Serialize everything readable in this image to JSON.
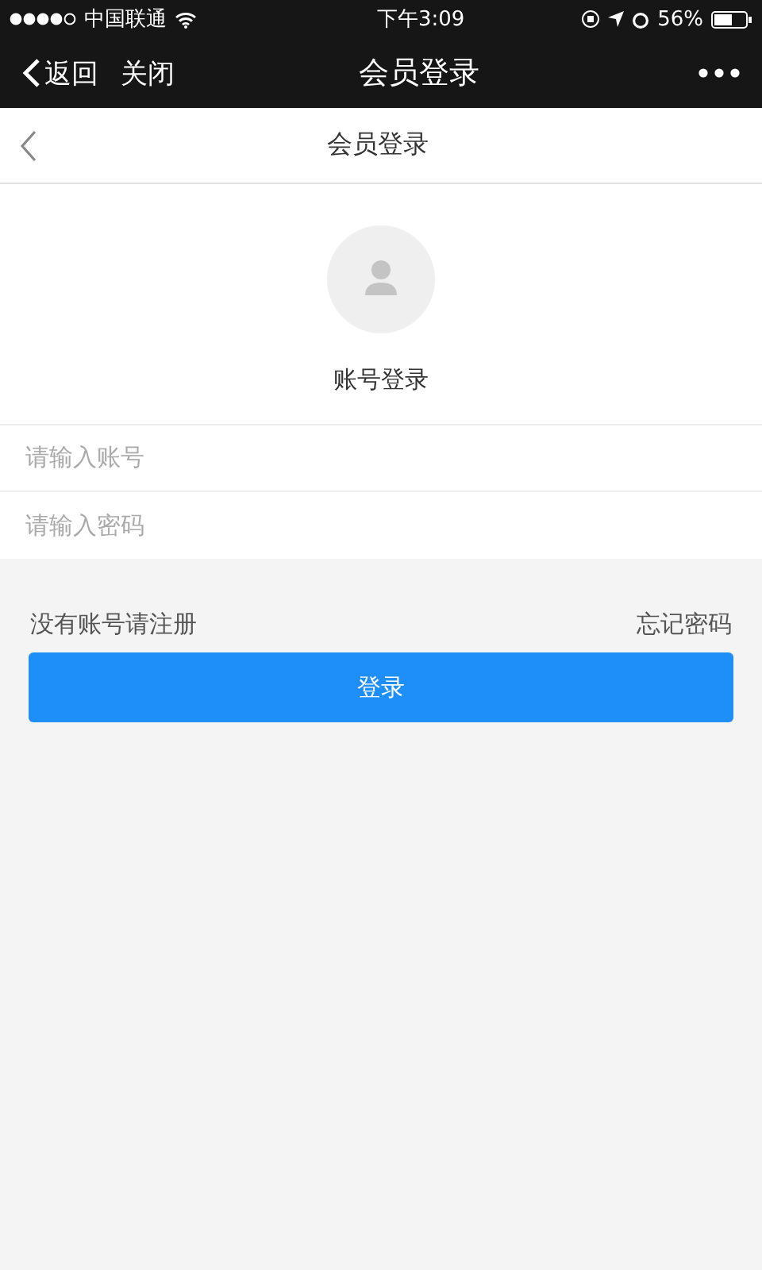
{
  "status_bar": {
    "carrier": "中国联通",
    "time": "下午3:09",
    "battery": "56%"
  },
  "nav_bar": {
    "back": "返回",
    "close": "关闭",
    "title": "会员登录"
  },
  "header": {
    "title": "会员登录"
  },
  "profile": {
    "label": "账号登录"
  },
  "fields": [
    {
      "placeholder": "请输入账号"
    },
    {
      "placeholder": "请输入密码"
    }
  ],
  "links": {
    "register": "没有账号请注册",
    "forgot": "忘记密码"
  },
  "login_button": "登录"
}
